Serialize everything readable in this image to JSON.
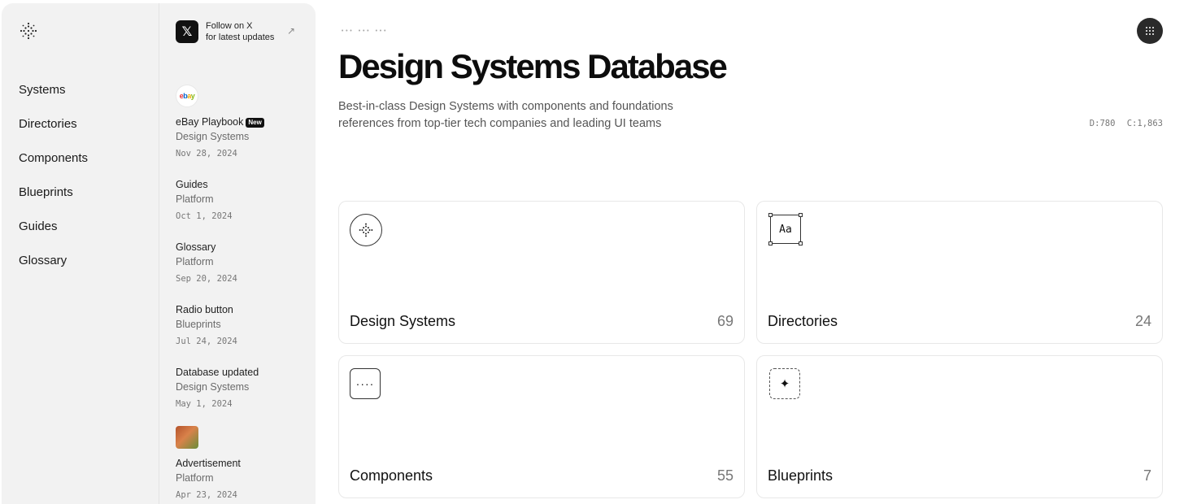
{
  "sidebar": {
    "nav": [
      "Systems",
      "Directories",
      "Components",
      "Blueprints",
      "Guides",
      "Glossary"
    ]
  },
  "feed": {
    "follow": {
      "line1": "Follow on X",
      "line2": "for latest updates",
      "arrow": "↗"
    },
    "entries": [
      {
        "title": "eBay Playbook",
        "badge": "New",
        "category": "Design Systems",
        "date": "Nov 28, 2024",
        "thumb": "ebay"
      },
      {
        "title": "Guides",
        "category": "Platform",
        "date": "Oct 1, 2024"
      },
      {
        "title": "Glossary",
        "category": "Platform",
        "date": "Sep 20, 2024"
      },
      {
        "title": "Radio button",
        "category": "Blueprints",
        "date": "Jul 24, 2024"
      },
      {
        "title": "Database updated",
        "category": "Design Systems",
        "date": "May 1, 2024"
      },
      {
        "title": "Advertisement",
        "category": "Platform",
        "date": "Apr 23, 2024"
      }
    ]
  },
  "header": {
    "breadcrumb": "••• ••• •••",
    "title": "Design Systems Database",
    "subtitle": "Best-in-class Design Systems with components and foundations references from top-tier tech companies and leading UI teams",
    "stats": [
      "D:780",
      "C:1,863"
    ]
  },
  "cards": [
    {
      "label": "Design Systems",
      "count": "69",
      "icon": "sparkle-dots-icon"
    },
    {
      "label": "Directories",
      "count": "24",
      "icon": "typography-icon",
      "icon_text": "Aa"
    },
    {
      "label": "Components",
      "count": "55",
      "icon": "dots-icon",
      "icon_text": "····"
    },
    {
      "label": "Blueprints",
      "count": "7",
      "icon": "star-icon",
      "icon_text": "✦"
    }
  ],
  "colors": {
    "sidebar_bg": "#f2f2f2",
    "menu_button": "#2a2a2a",
    "text": "#111111"
  }
}
